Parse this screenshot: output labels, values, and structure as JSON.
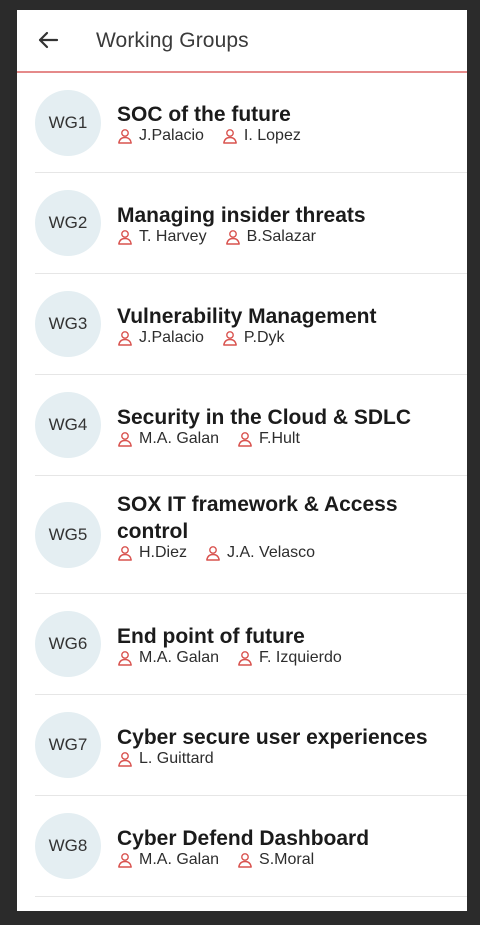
{
  "header": {
    "title": "Working Groups"
  },
  "groups": [
    {
      "code": "WG1",
      "name": "SOC of the future",
      "leads": [
        "J.Palacio",
        "I. Lopez"
      ]
    },
    {
      "code": "WG2",
      "name": "Managing insider threats",
      "leads": [
        "T. Harvey",
        "B.Salazar"
      ]
    },
    {
      "code": "WG3",
      "name": "Vulnerability Management",
      "leads": [
        "J.Palacio",
        "P.Dyk"
      ]
    },
    {
      "code": "WG4",
      "name": "Security in the Cloud & SDLC",
      "leads": [
        "M.A. Galan",
        "F.Hult"
      ]
    },
    {
      "code": "WG5",
      "name": "SOX IT framework & Access control",
      "leads": [
        "H.Diez",
        "J.A. Velasco"
      ]
    },
    {
      "code": "WG6",
      "name": "End point of future",
      "leads": [
        "M.A. Galan",
        "F. Izquierdo"
      ]
    },
    {
      "code": "WG7",
      "name": "Cyber secure user experiences",
      "leads": [
        "L. Guittard"
      ]
    },
    {
      "code": "WG8",
      "name": "Cyber Defend Dashboard",
      "leads": [
        "M.A. Galan",
        "S.Moral"
      ]
    }
  ],
  "colors": {
    "accent": "#e58a8a",
    "avatar_bg": "#e4eef2",
    "person_icon": "#d9534f"
  },
  "icons": {
    "back": "arrow-left-icon",
    "person": "person-icon"
  }
}
